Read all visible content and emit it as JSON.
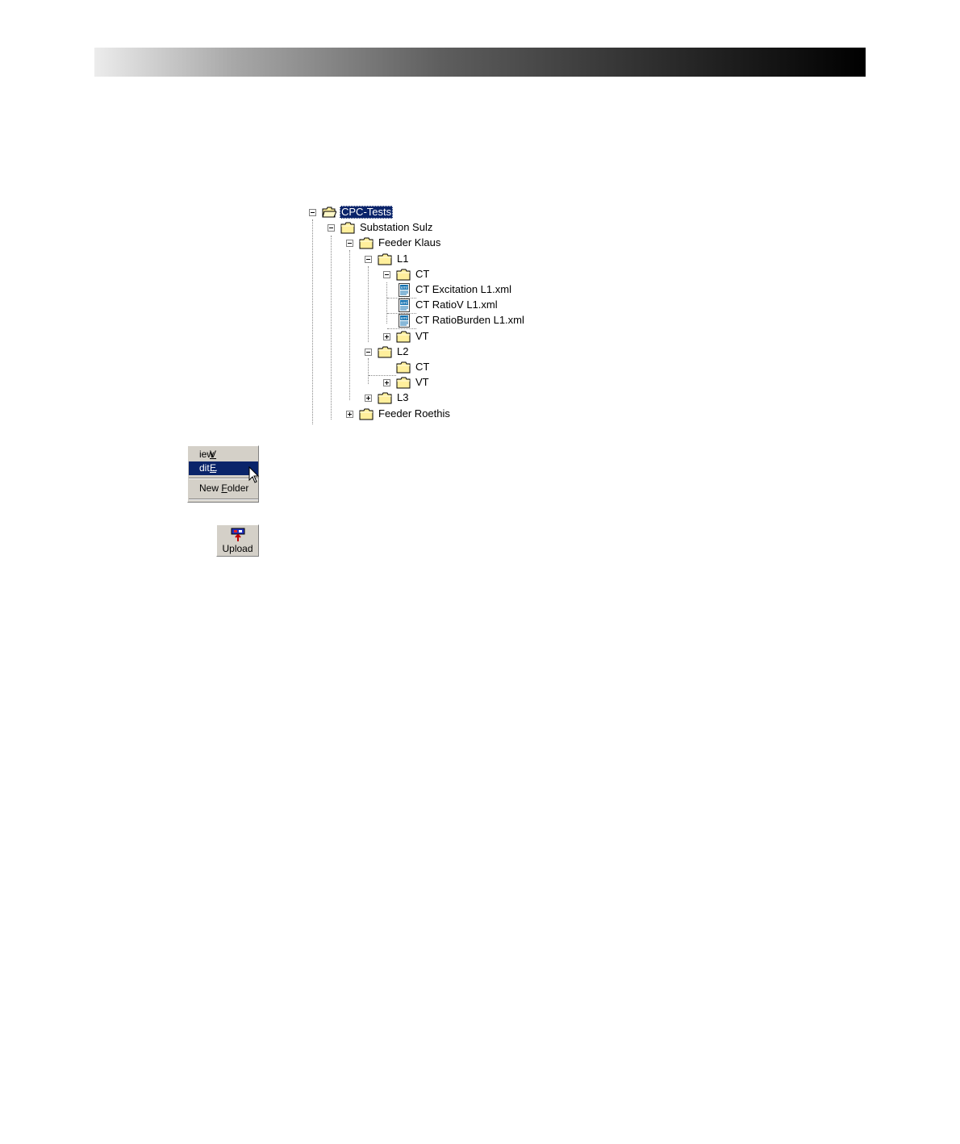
{
  "tree": {
    "nodes": [
      {
        "label": "CPC-Tests",
        "level": 0,
        "expander": "minus",
        "icon": "open-folder-icon",
        "selected": true
      },
      {
        "label": "Substation Sulz",
        "level": 1,
        "expander": "minus",
        "icon": "folder-icon"
      },
      {
        "label": "Feeder Klaus",
        "level": 2,
        "expander": "minus",
        "icon": "folder-icon"
      },
      {
        "label": "L1",
        "level": 3,
        "expander": "minus",
        "icon": "folder-icon"
      },
      {
        "label": "CT",
        "level": 4,
        "expander": "minus",
        "icon": "folder-icon"
      },
      {
        "label": "CT Excitation L1.xml",
        "level": 5,
        "expander": "none",
        "icon": "xml-file-icon"
      },
      {
        "label": "CT RatioV L1.xml",
        "level": 5,
        "expander": "none",
        "icon": "xml-file-icon"
      },
      {
        "label": "CT RatioBurden L1.xml",
        "level": 5,
        "expander": "none",
        "icon": "xml-file-icon"
      },
      {
        "label": "VT",
        "level": 4,
        "expander": "plus",
        "icon": "folder-icon"
      },
      {
        "label": "L2",
        "level": 3,
        "expander": "minus",
        "icon": "folder-icon"
      },
      {
        "label": "CT",
        "level": 4,
        "expander": "none",
        "icon": "folder-icon"
      },
      {
        "label": "VT",
        "level": 4,
        "expander": "plus",
        "icon": "folder-icon"
      },
      {
        "label": "L3",
        "level": 3,
        "expander": "plus",
        "icon": "folder-icon"
      },
      {
        "label": "Feeder Roethis",
        "level": 2,
        "expander": "plus",
        "icon": "folder-icon"
      }
    ]
  },
  "context_menu": {
    "items": [
      {
        "label": "View",
        "mnemonic": "V",
        "highlighted": false
      },
      {
        "label": "Edit...",
        "mnemonic": "E",
        "highlighted": true
      },
      {
        "label": "New Folder",
        "mnemonic": "F",
        "highlighted": false
      }
    ]
  },
  "upload_button": {
    "label": "Upload",
    "icon": "upload-icon"
  },
  "colors": {
    "selection": "#0a246a",
    "face": "#d4d0c8",
    "folder": "#ffef9c"
  }
}
